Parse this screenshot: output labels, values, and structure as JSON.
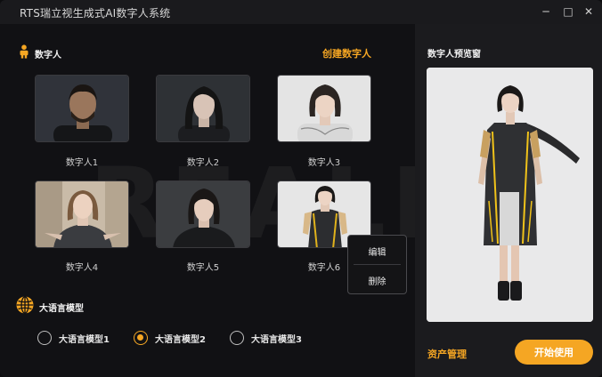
{
  "window": {
    "title": "RTS瑞立视生成式AI数字人系统",
    "controls": {
      "minimize": "─",
      "maximize": "□",
      "close": "✕"
    }
  },
  "digital_humans": {
    "section_title": "数字人",
    "create_label": "创建数字人",
    "items": [
      {
        "label": "数字人1"
      },
      {
        "label": "数字人2"
      },
      {
        "label": "数字人3"
      },
      {
        "label": "数字人4"
      },
      {
        "label": "数字人5"
      },
      {
        "label": "数字人6"
      }
    ],
    "context_menu": {
      "edit": "编辑",
      "delete": "删除"
    }
  },
  "llm": {
    "section_title": "大语言模型",
    "options": [
      {
        "label": "大语言模型1",
        "selected": false
      },
      {
        "label": "大语言模型2",
        "selected": true
      },
      {
        "label": "大语言模型3",
        "selected": false
      }
    ]
  },
  "preview": {
    "title": "数字人预览窗",
    "asset_label": "资产管理",
    "start_label": "开始使用"
  },
  "watermark": "REALIS",
  "colors": {
    "accent": "#f5a623",
    "background": "#111114",
    "panel": "#1b1b1e"
  }
}
